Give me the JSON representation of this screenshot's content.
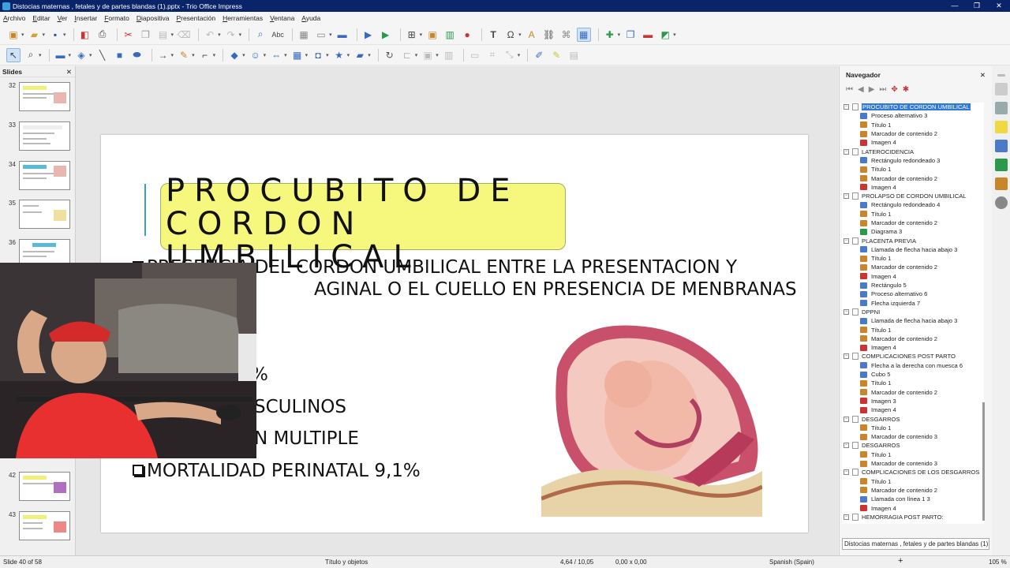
{
  "window": {
    "title": "Distocias maternas , fetales y de partes blandas (1).pptx - Trio Office Impress",
    "controls": [
      "—",
      "❐",
      "✕"
    ]
  },
  "menu": [
    "Archivo",
    "Editar",
    "Ver",
    "Insertar",
    "Formato",
    "Diapositiva",
    "Presentación",
    "Herramientas",
    "Ventana",
    "Ayuda"
  ],
  "slides_panel": {
    "header": "Slides",
    "close": "✕",
    "thumbs": [
      {
        "num": "32"
      },
      {
        "num": "33"
      },
      {
        "num": "34"
      },
      {
        "num": "35"
      },
      {
        "num": "36"
      },
      {
        "num": "42"
      },
      {
        "num": "43"
      }
    ]
  },
  "slide": {
    "title": "PROCUBITO DE CORDON UMBILICAL",
    "bullets": [
      {
        "text": "PRESENCIA DEL CORDON UMBILICAL ENTRE LA PRESENTACION Y"
      },
      {
        "text": "AGINAL O EL CUELLO EN PRESENCIA DE MENBRANAS"
      },
      {
        "text": "%"
      },
      {
        "text": "SCULINOS"
      },
      {
        "text": "N MULTIPLE"
      },
      {
        "text": "MORTALIDAD PERINATAL 9,1%"
      }
    ]
  },
  "navigator": {
    "header": "Navegador",
    "close": "✕",
    "items": [
      {
        "level": 0,
        "label": "PROCUBITO DE CORDON UMBILICAL",
        "selected": true
      },
      {
        "level": 1,
        "label": "Proceso alternativo 3",
        "icon": "shape-icon"
      },
      {
        "level": 1,
        "label": "Título 1",
        "icon": "text-icon"
      },
      {
        "level": 1,
        "label": "Marcador de contenido 2",
        "icon": "text-icon"
      },
      {
        "level": 1,
        "label": "Imagen 4",
        "icon": "image-icon"
      },
      {
        "level": 0,
        "label": "LATEROCIDENCIA"
      },
      {
        "level": 1,
        "label": "Rectángulo redondeado 3",
        "icon": "shape-icon"
      },
      {
        "level": 1,
        "label": "Título 1",
        "icon": "text-icon"
      },
      {
        "level": 1,
        "label": "Marcador de contenido 2",
        "icon": "text-icon"
      },
      {
        "level": 1,
        "label": "Imagen 4",
        "icon": "image-icon"
      },
      {
        "level": 0,
        "label": "PROLAPSO DE CORDON UMBILICAL"
      },
      {
        "level": 1,
        "label": "Rectángulo redondeado 4",
        "icon": "shape-icon"
      },
      {
        "level": 1,
        "label": "Título 1",
        "icon": "text-icon"
      },
      {
        "level": 1,
        "label": "Marcador de contenido 2",
        "icon": "text-icon"
      },
      {
        "level": 1,
        "label": "Diagrama 3",
        "icon": "diagram-icon"
      },
      {
        "level": 0,
        "label": "PLACENTA PREVIA"
      },
      {
        "level": 1,
        "label": "Llamada de flecha hacia abajo 3",
        "icon": "shape-icon"
      },
      {
        "level": 1,
        "label": "Título 1",
        "icon": "text-icon"
      },
      {
        "level": 1,
        "label": "Marcador de contenido 2",
        "icon": "text-icon"
      },
      {
        "level": 1,
        "label": "Imagen 4",
        "icon": "image-icon"
      },
      {
        "level": 1,
        "label": "Rectángulo 5",
        "icon": "shape-icon"
      },
      {
        "level": 1,
        "label": "Proceso alternativo 6",
        "icon": "shape-icon"
      },
      {
        "level": 1,
        "label": "Flecha izquierda 7",
        "icon": "shape-icon"
      },
      {
        "level": 0,
        "label": "DPPNI"
      },
      {
        "level": 1,
        "label": "Llamada de flecha hacia abajo 3",
        "icon": "shape-icon"
      },
      {
        "level": 1,
        "label": "Título 1",
        "icon": "text-icon"
      },
      {
        "level": 1,
        "label": "Marcador de contenido 2",
        "icon": "text-icon"
      },
      {
        "level": 1,
        "label": "Imagen 4",
        "icon": "image-icon"
      },
      {
        "level": 0,
        "label": "COMPLICACIONES POST PARTO"
      },
      {
        "level": 1,
        "label": "Flecha a la derecha con muesca 6",
        "icon": "shape-icon"
      },
      {
        "level": 1,
        "label": "Cubo 5",
        "icon": "shape-icon"
      },
      {
        "level": 1,
        "label": "Título 1",
        "icon": "text-icon"
      },
      {
        "level": 1,
        "label": "Marcador de contenido 2",
        "icon": "text-icon"
      },
      {
        "level": 1,
        "label": "Imagen 3",
        "icon": "image-icon"
      },
      {
        "level": 1,
        "label": "Imagen 4",
        "icon": "image-icon"
      },
      {
        "level": 0,
        "label": "DESGARROS"
      },
      {
        "level": 1,
        "label": "Título 1",
        "icon": "text-icon"
      },
      {
        "level": 1,
        "label": "Marcador de contenido 3",
        "icon": "text-icon"
      },
      {
        "level": 0,
        "label": "DESGARROS"
      },
      {
        "level": 1,
        "label": "Título 1",
        "icon": "text-icon"
      },
      {
        "level": 1,
        "label": "Marcador de contenido 3",
        "icon": "text-icon"
      },
      {
        "level": 0,
        "label": "COMPLICACIONES DE LOS DESGARROS"
      },
      {
        "level": 1,
        "label": "Título 1",
        "icon": "text-icon"
      },
      {
        "level": 1,
        "label": "Marcador de contenido 2",
        "icon": "text-icon"
      },
      {
        "level": 1,
        "label": "Llamada con línea 1 3",
        "icon": "shape-icon"
      },
      {
        "level": 1,
        "label": "Imagen 4",
        "icon": "image-icon"
      },
      {
        "level": 0,
        "label": "HEMORRAGIA POST PARTO:"
      }
    ],
    "document_select": "Distocias maternas , fetales y de partes blandas (1)"
  },
  "status": {
    "slide": "Slide 40 of 58",
    "layout": "Título y objetos",
    "position": "4,64 / 10,05",
    "size": "0,00 x 0,00",
    "language": "Spanish (Spain)",
    "zoom": "105 %"
  },
  "colors": {
    "title_fill": "#f6f77d",
    "accent": "#3aa3b8",
    "selection": "#3079d8"
  }
}
